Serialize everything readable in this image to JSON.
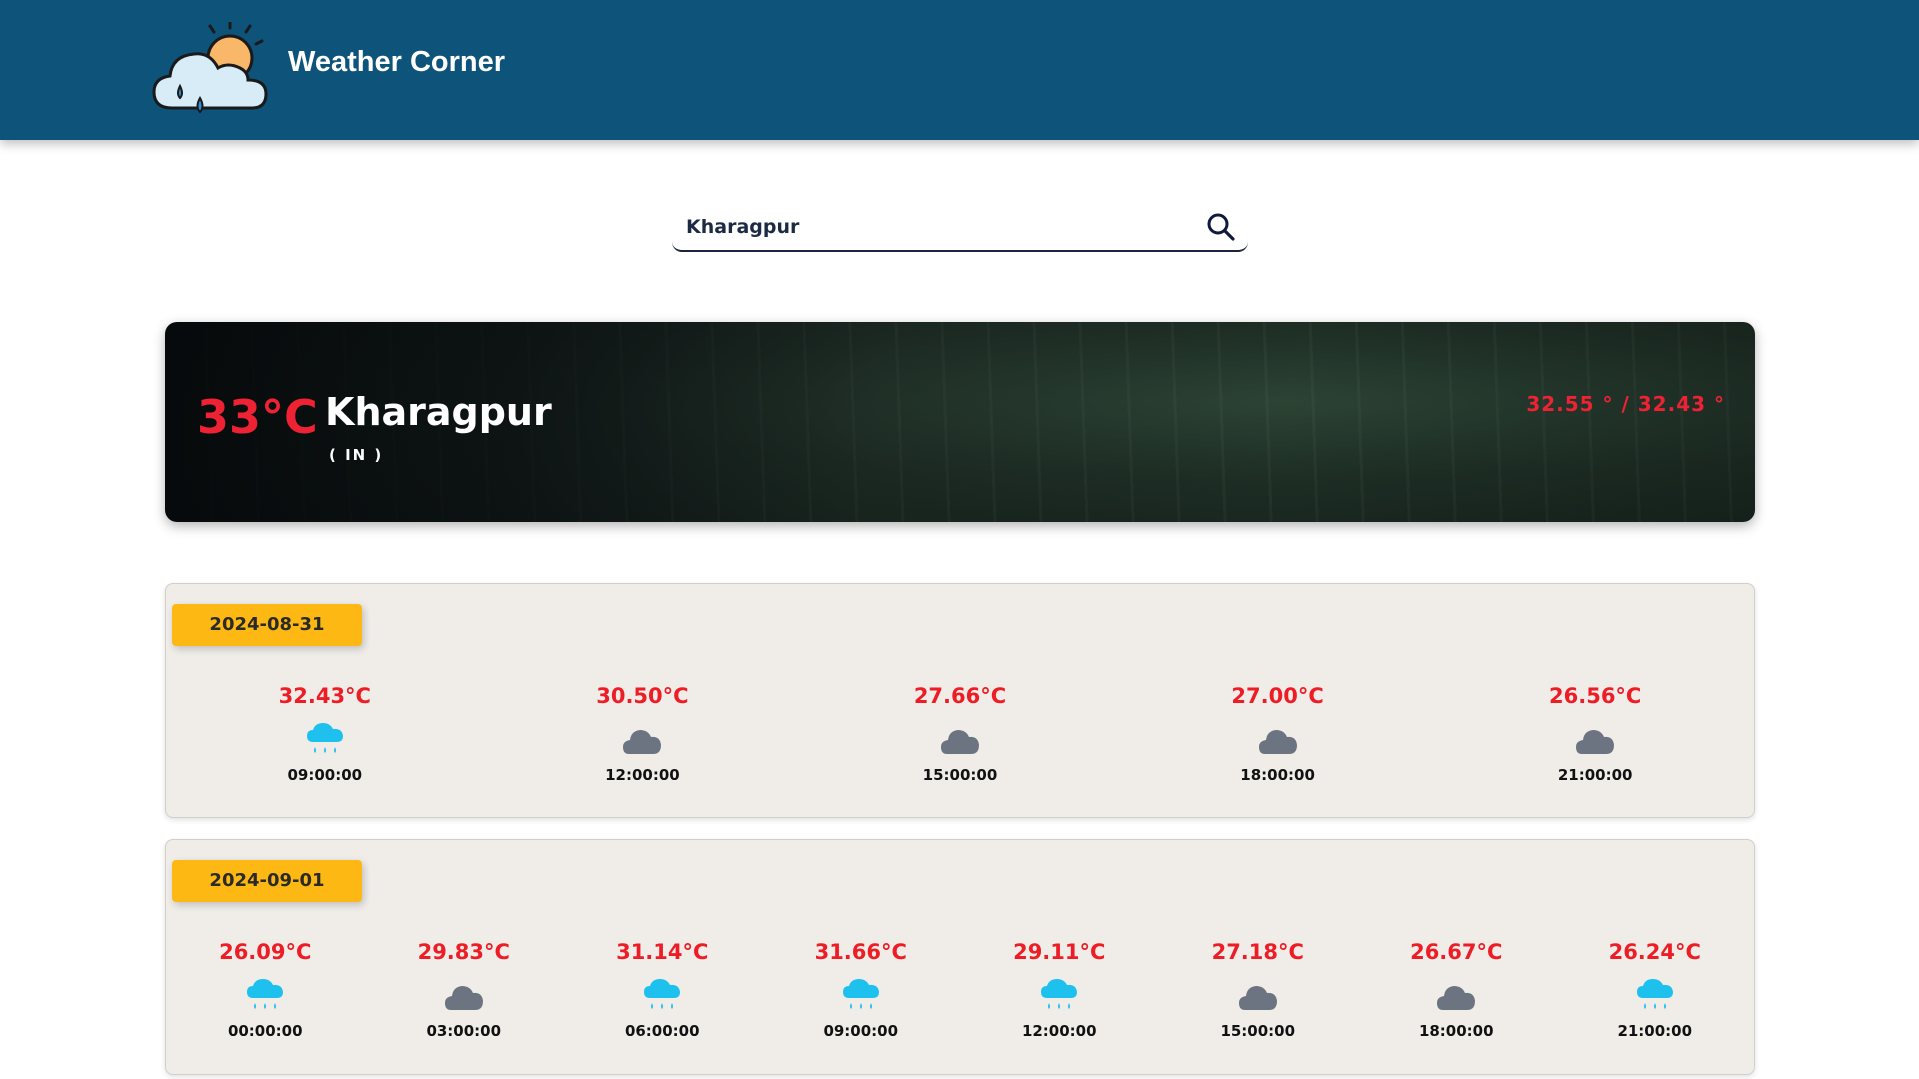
{
  "header": {
    "brand": "Weather Corner",
    "logo_icon": "cloud-sun-rain-icon",
    "bg_color": "#0e5379"
  },
  "search": {
    "value": "Kharagpur",
    "icon": "search-icon"
  },
  "current": {
    "temp": "33°C",
    "city": "Kharagpur",
    "country": "( IN )",
    "range": "32.55 ° / 32.43 °"
  },
  "days": [
    {
      "date": "2024-08-31",
      "slots": [
        {
          "temp": "32.43°C",
          "time": "09:00:00",
          "icon": "rain-cloud-icon"
        },
        {
          "temp": "30.50°C",
          "time": "12:00:00",
          "icon": "cloud-icon"
        },
        {
          "temp": "27.66°C",
          "time": "15:00:00",
          "icon": "cloud-icon"
        },
        {
          "temp": "27.00°C",
          "time": "18:00:00",
          "icon": "cloud-icon"
        },
        {
          "temp": "26.56°C",
          "time": "21:00:00",
          "icon": "cloud-icon"
        }
      ]
    },
    {
      "date": "2024-09-01",
      "slots": [
        {
          "temp": "26.09°C",
          "time": "00:00:00",
          "icon": "rain-cloud-icon"
        },
        {
          "temp": "29.83°C",
          "time": "03:00:00",
          "icon": "cloud-icon"
        },
        {
          "temp": "31.14°C",
          "time": "06:00:00",
          "icon": "rain-cloud-icon"
        },
        {
          "temp": "31.66°C",
          "time": "09:00:00",
          "icon": "rain-cloud-icon"
        },
        {
          "temp": "29.11°C",
          "time": "12:00:00",
          "icon": "rain-cloud-icon"
        },
        {
          "temp": "27.18°C",
          "time": "15:00:00",
          "icon": "cloud-icon"
        },
        {
          "temp": "26.67°C",
          "time": "18:00:00",
          "icon": "cloud-icon"
        },
        {
          "temp": "26.24°C",
          "time": "21:00:00",
          "icon": "rain-cloud-icon"
        }
      ]
    }
  ],
  "colors": {
    "accent_red": "#ee1c25",
    "badge_yellow": "#fdb813",
    "rain_blue": "#1ec0ee",
    "cloud_gray": "#6b7480"
  }
}
